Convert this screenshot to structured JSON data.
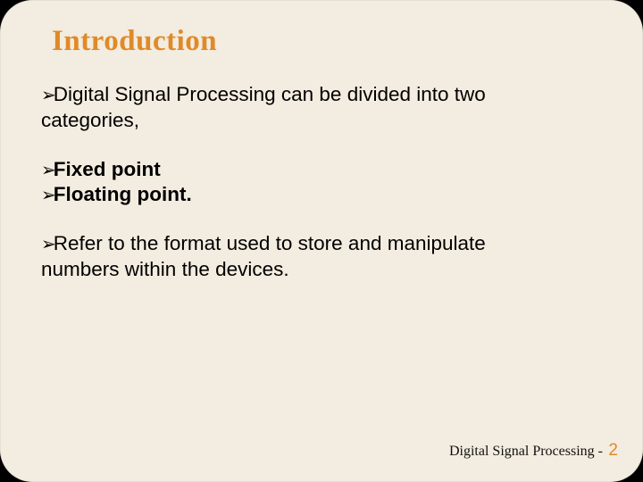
{
  "title": "Introduction",
  "bullet_char": "➢",
  "para1": {
    "line1_after_bullet": "Digital Signal Processing can be divided into two",
    "line2": "categories,"
  },
  "fixed": "Fixed point",
  "floating": "Floating point.",
  "para2": {
    "line1_after_bullet": "Refer to the format used to store and manipulate",
    "line2": "numbers within the devices."
  },
  "footer": {
    "text": "Digital Signal Processing -",
    "page": "2"
  }
}
